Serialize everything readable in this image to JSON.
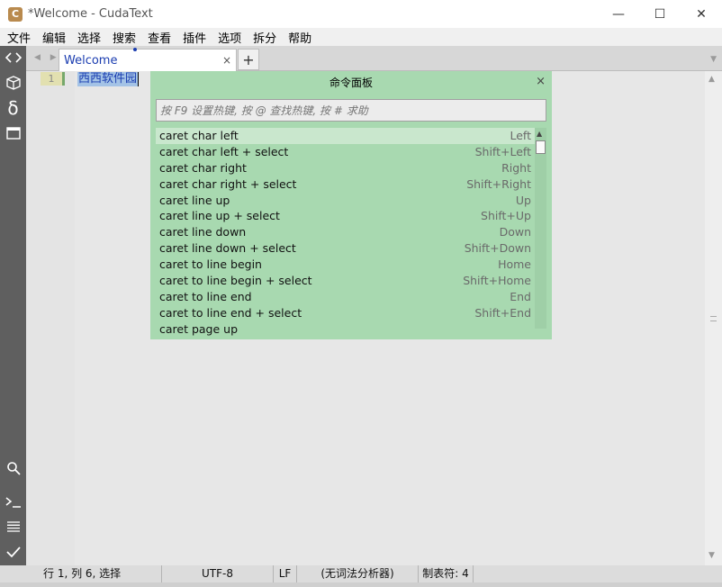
{
  "window": {
    "title": "*Welcome - CudaText",
    "app_icon_letter": "C",
    "minimize": "—",
    "maximize": "☐",
    "close": "✕"
  },
  "menu": [
    "文件",
    "编辑",
    "选择",
    "搜索",
    "查看",
    "插件",
    "选项",
    "拆分",
    "帮助"
  ],
  "tabs": {
    "nav_arrows": "◀ ▶",
    "active_tab": "Welcome",
    "close_glyph": "×",
    "add_glyph": "+",
    "menu_glyph": "▼"
  },
  "editor": {
    "line_number": "1",
    "line_text": "西西软件园"
  },
  "command_palette": {
    "title": "命令面板",
    "close_glyph": "×",
    "placeholder": "按 F9 设置热键, 按 @ 查找热键, 按 # 求助",
    "items": [
      {
        "command": "caret char left",
        "hotkey": "Left"
      },
      {
        "command": "caret char left + select",
        "hotkey": "Shift+Left"
      },
      {
        "command": "caret char right",
        "hotkey": "Right"
      },
      {
        "command": "caret char right + select",
        "hotkey": "Shift+Right"
      },
      {
        "command": "caret line up",
        "hotkey": "Up"
      },
      {
        "command": "caret line up + select",
        "hotkey": "Shift+Up"
      },
      {
        "command": "caret line down",
        "hotkey": "Down"
      },
      {
        "command": "caret line down + select",
        "hotkey": "Shift+Down"
      },
      {
        "command": "caret to line begin",
        "hotkey": "Home"
      },
      {
        "command": "caret to line begin + select",
        "hotkey": "Shift+Home"
      },
      {
        "command": "caret to line end",
        "hotkey": "End"
      },
      {
        "command": "caret to line end + select",
        "hotkey": "Shift+End"
      },
      {
        "command": "caret page up",
        "hotkey": ""
      }
    ]
  },
  "side_icons": [
    "code-tree-icon",
    "project-box-icon",
    "snippets-delta-icon",
    "tabs-panel-icon",
    "search-icon",
    "console-icon",
    "output-list-icon",
    "validate-check-icon"
  ],
  "statusbar": {
    "position": "行 1, 列 6, 选择",
    "encoding": "UTF-8",
    "line_ending": "LF",
    "lexer": "(无词法分析器)",
    "tab_size": "制表符: 4"
  },
  "colors": {
    "palette_bg": "#a8d9b0",
    "side_panel": "#5f5f5f",
    "selection": "#a4c3e6"
  }
}
